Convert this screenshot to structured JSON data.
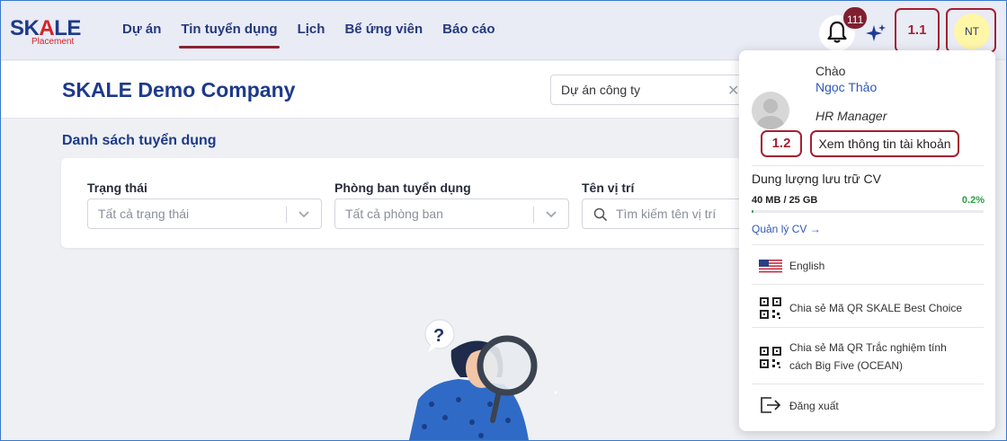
{
  "brand": {
    "logo_main_a": "SK",
    "logo_main_b": "A",
    "logo_main_c": "LE",
    "logo_sub": "Placement"
  },
  "nav": {
    "items": [
      "Dự án",
      "Tin tuyển dụng",
      "Lịch",
      "Bể ứng viên",
      "Báo cáo"
    ],
    "active_index": 1
  },
  "notifications": {
    "count": "111"
  },
  "callouts": {
    "user_menu": "1.1",
    "view_account": "1.2"
  },
  "user": {
    "initials": "NT",
    "greeting": "Chào",
    "name": "Ngọc Thảo",
    "role": "HR Manager"
  },
  "company": {
    "title": "SKALE Demo Company",
    "project_select": "Dự án công ty"
  },
  "listing": {
    "title": "Danh sách tuyển dụng",
    "filters": {
      "status": {
        "label": "Trạng thái",
        "placeholder": "Tất cả trạng thái"
      },
      "department": {
        "label": "Phòng ban tuyển dụng",
        "placeholder": "Tất cả phòng ban"
      },
      "position": {
        "label": "Tên vị trí",
        "placeholder": "Tìm kiếm tên vị trí"
      }
    }
  },
  "menu": {
    "view_account": "Xem thông tin tài khoản",
    "storage": {
      "title": "Dung lượng lưu trữ CV",
      "used": "40 MB / 25 GB",
      "percent": "0.2%",
      "fraction": 0.002
    },
    "manage_cv": "Quản lý CV →",
    "language": "English",
    "qr_best_choice": "Chia sẻ Mã QR SKALE Best Choice",
    "qr_big_five_line1": "Chia sẻ Mã QR Trắc nghiệm tính",
    "qr_big_five_line2": "cách Big Five (OCEAN)",
    "logout": "Đăng xuất"
  },
  "colors": {
    "brand_blue": "#1d3a8a",
    "accent_maroon": "#8b2332",
    "callout_red": "#a32131",
    "success_green": "#2e9e45"
  }
}
